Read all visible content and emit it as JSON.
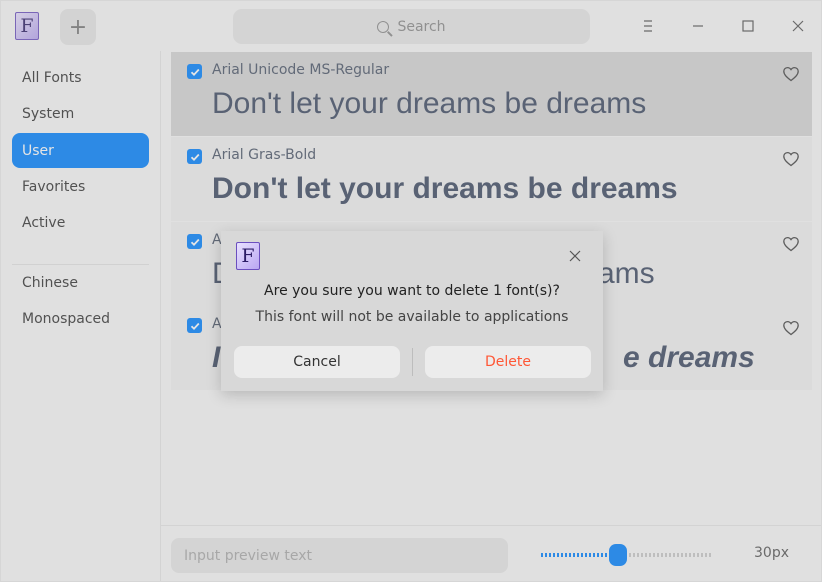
{
  "titlebar": {
    "app_icon_letter": "F",
    "add_button": "+",
    "search_placeholder": "Search"
  },
  "sidebar": {
    "items": [
      {
        "label": "All Fonts",
        "active": false
      },
      {
        "label": "System",
        "active": false
      },
      {
        "label": "User",
        "active": true
      },
      {
        "label": "Favorites",
        "active": false
      },
      {
        "label": "Active",
        "active": false
      }
    ],
    "groups": [
      {
        "label": "Chinese"
      },
      {
        "label": "Monospaced"
      }
    ]
  },
  "fonts": [
    {
      "name": "Arial Unicode MS-Regular",
      "preview": "Don't let your dreams be dreams",
      "checked": true,
      "selected": true
    },
    {
      "name": "Arial Gras-Bold",
      "preview": "Don't let your dreams be dreams",
      "checked": true,
      "selected": false
    },
    {
      "name": "A",
      "preview": "D",
      "preview_tail": "ams",
      "checked": true,
      "selected": false
    },
    {
      "name": "A",
      "preview": "I",
      "preview_tail": "e dreams",
      "checked": true,
      "selected": false
    }
  ],
  "bottom": {
    "input_placeholder": "Input preview text",
    "size_label": "30px",
    "slider_fraction": 0.45
  },
  "dialog": {
    "icon_letter": "F",
    "title": "Are you sure you want to delete 1 font(s)?",
    "message": "This font will not be available to applications",
    "cancel_label": "Cancel",
    "delete_label": "Delete"
  },
  "colors": {
    "accent": "#0081ff",
    "delete": "#ff5736"
  },
  "icons": [
    "app-icon",
    "plus-icon",
    "search-icon",
    "menu-icon",
    "minimize-icon",
    "maximize-icon",
    "close-icon",
    "checkbox-icon",
    "heart-icon"
  ]
}
